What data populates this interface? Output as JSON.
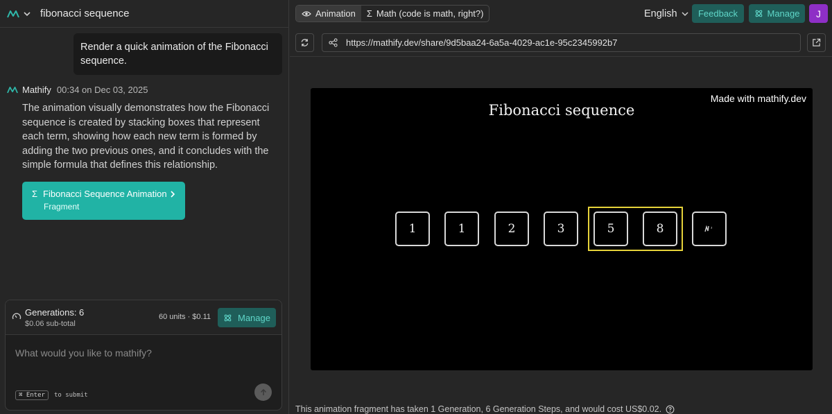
{
  "project": {
    "title": "fibonacci sequence"
  },
  "chat": {
    "user_message": "Render a quick animation of the Fibonacci sequence.",
    "assistant": {
      "name": "Mathify",
      "timestamp": "00:34 on Dec 03, 2025",
      "body": "The animation visually demonstrates how the Fibonacci sequence is created by stacking boxes that represent each term, showing how each new term is formed by adding the two previous ones, and it concludes with the simple formula that defines this relationship."
    },
    "fragment": {
      "title": "Fibonacci Sequence Animation",
      "subtitle": "Fragment",
      "icon": "sigma-icon"
    }
  },
  "composer": {
    "generations": "Generations: 6",
    "subtotal": "$0.06 sub-total",
    "units": "60 units · $0.11",
    "manage_label": "Manage",
    "placeholder": "What would you like to mathify?",
    "key_hint": "⌘ Enter",
    "hint_text": "to submit"
  },
  "toolbar": {
    "tabs": [
      {
        "label": "Animation",
        "icon": "eye-icon",
        "active": true
      },
      {
        "label": "Math (code is math, right?)",
        "icon": "sigma-icon",
        "active": false
      }
    ],
    "language": "English",
    "feedback_label": "Feedback",
    "manage_label": "Manage",
    "avatar_initial": "J"
  },
  "share": {
    "url": "https://mathify.dev/share/9d5baa24-6a5a-4029-ac1e-95c2345992b7"
  },
  "animation": {
    "watermark": "Made with mathify.dev",
    "title": "Fibonacci sequence",
    "terms": [
      "1",
      "1",
      "2",
      "3",
      "5",
      "8"
    ],
    "highlighted_terms": [
      4,
      5
    ],
    "last_box_glyph": "",
    "highlight_color": "#e6d33a"
  },
  "footer": {
    "text": "This animation fragment has taken 1 Generation, 6 Generation Steps, and would cost US$0.02."
  },
  "colors": {
    "accent": "#21b3a5",
    "accent_dark": "#1f5e59",
    "avatar": "#8e2fc6"
  }
}
